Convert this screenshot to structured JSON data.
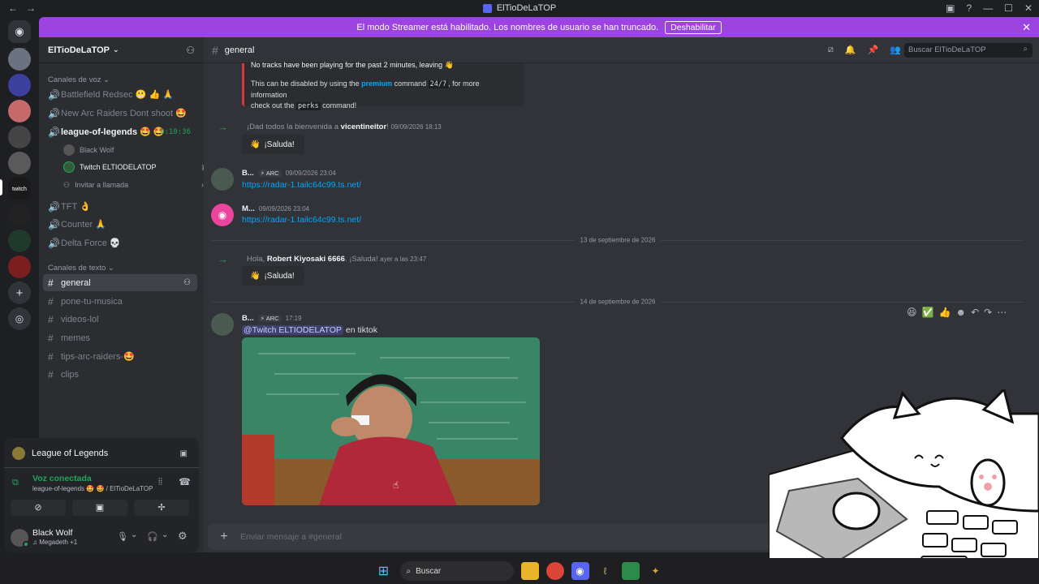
{
  "titlebar": {
    "title": "ElTioDeLaTOP"
  },
  "banner": {
    "text": "El modo Streamer está habilitado. Los nombres de usuario se han truncado.",
    "button": "Deshabilitar"
  },
  "server": {
    "name": "ElTioDeLaTOP"
  },
  "voice_category": "Canales de voz",
  "voice_channels": [
    {
      "name": "Battlefield Redsec 😬 👍 🙏"
    },
    {
      "name": "New Arc Raiders Dont shoot 🤩"
    },
    {
      "name": "league-of-legends 🤩 🤩",
      "timer": "9:10:36"
    },
    {
      "name": "TFT 👌"
    },
    {
      "name": "Counter 🙏"
    },
    {
      "name": "Delta Force 💀"
    }
  ],
  "voice_users": [
    "Black Wolf",
    "Twitch ELTIODELATOP"
  ],
  "invite_call": "Invitar a llamada",
  "text_category": "Canales de texto",
  "text_channels": [
    {
      "name": "general"
    },
    {
      "name": "pone-tu-musica"
    },
    {
      "name": "videos-lol"
    },
    {
      "name": "memes"
    },
    {
      "name": "tips-arc-raiders-🤩"
    },
    {
      "name": "clips"
    }
  ],
  "panel": {
    "activity": "League of Legends",
    "status": "Voz conectada",
    "sub": "league-of-legends 🤩 🤩 / ElTioDeLaTOP",
    "user": "Black Wolf",
    "user_status": "♫ Megadeth +1"
  },
  "channel": {
    "name": "general",
    "search_placeholder": "Buscar ElTioDeLaTOP"
  },
  "embed": {
    "line0": "No tracks have been playing for the past 2 minutes, leaving 👋",
    "pre": "This can be disabled by using the ",
    "premium": "premium",
    "cmd1": " command ",
    "code1": "24/7",
    "post1": ", for more information",
    "check": "check out the ",
    "code2": "perks",
    "post2": " command!"
  },
  "messages": {
    "join1": {
      "pre": "¡Dad todos la bienvenida a ",
      "name": "vicentineitor",
      "post": "!",
      "ts": "09/09/2026 18:13"
    },
    "sticker": "¡Saluda!",
    "m1": {
      "name": "B...",
      "tag": "⚡ ARC",
      "ts": "09/09/2026 23:04",
      "link": "https://radar-1.tailc64c99.ts.net/"
    },
    "m2": {
      "name": "M...",
      "ts": "09/09/2026 23:04",
      "link": "https://radar-1.tailc64c99.ts.net/"
    },
    "div1": "13 de septiembre de 2026",
    "join2": {
      "pre": "Hola, ",
      "name": "Robert Kiyosaki 6666",
      "post": ". ¡Saluda!",
      "ts": "ayer a las 23:47"
    },
    "div2": "14 de septiembre de 2026",
    "m3": {
      "name": "B...",
      "tag": "⚡ ARC",
      "ts": "17:19",
      "mention": "@Twitch ELTIODELATOP",
      "text": " en tiktok"
    }
  },
  "composer_placeholder": "Enviar mensaje a #general",
  "taskbar": {
    "search": "Buscar"
  },
  "colors": {
    "accent": "#5865f2",
    "banner": "#9b44e0",
    "green": "#23a55a"
  }
}
